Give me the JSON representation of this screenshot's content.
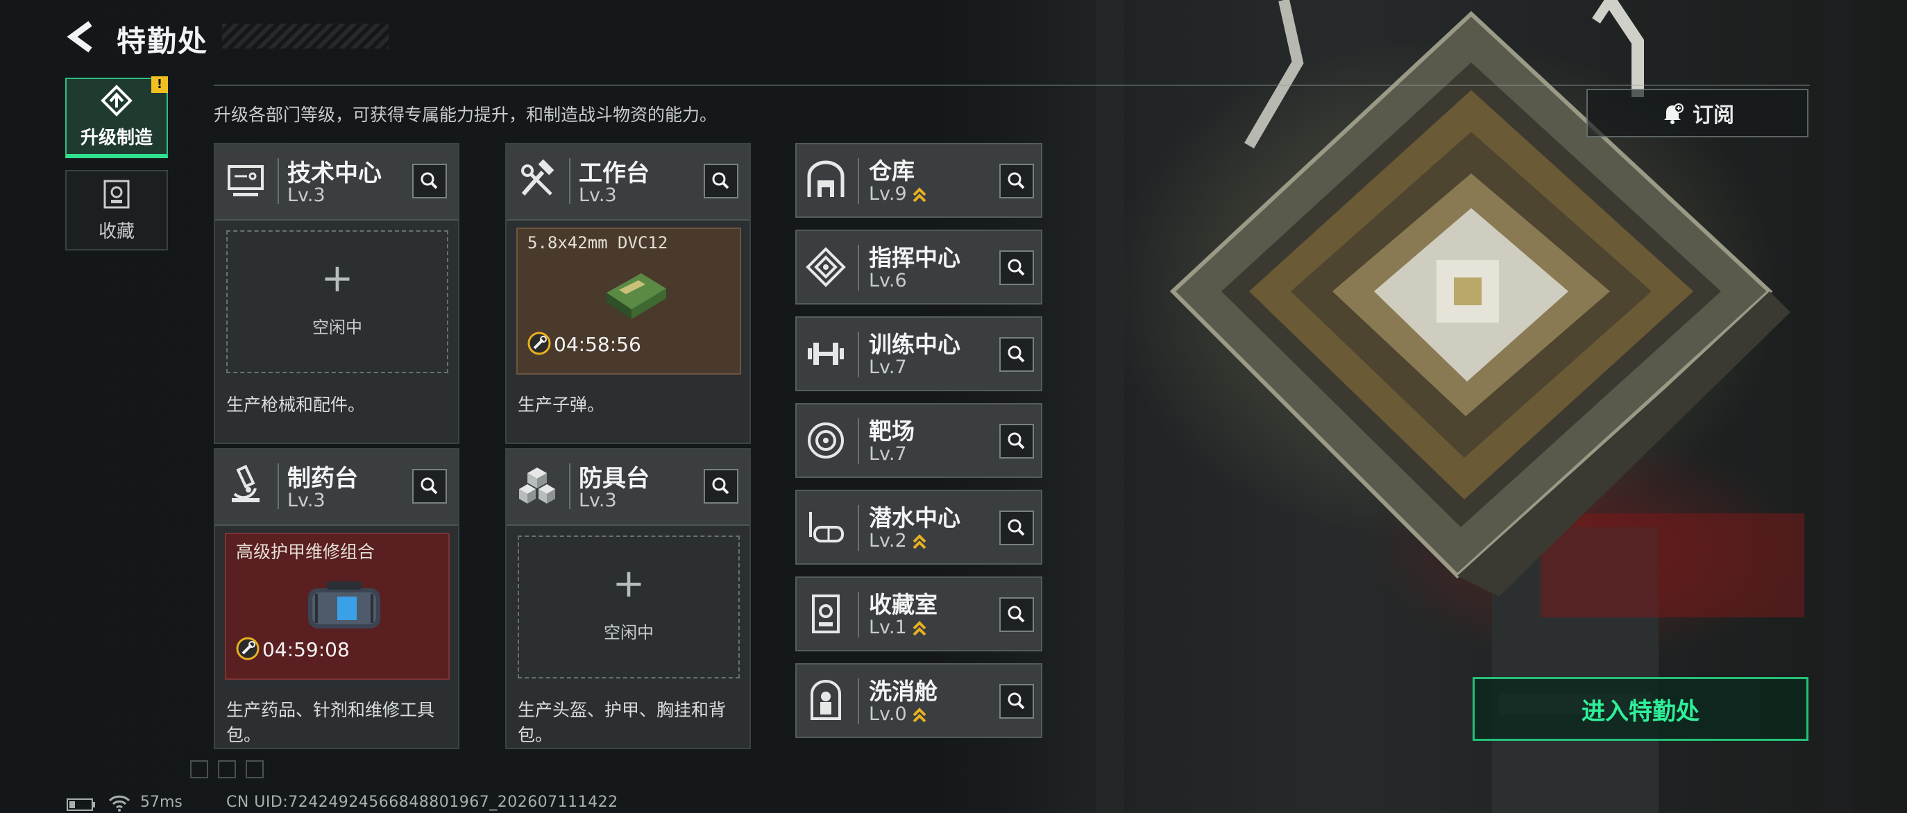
{
  "header": {
    "title": "特勤处",
    "back_icon": "back-arrow-icon"
  },
  "side_tabs": [
    {
      "label": "升级制造",
      "icon": "upgrade-factory-icon",
      "active": true,
      "alert": "!"
    },
    {
      "label": "收藏",
      "icon": "collection-icon",
      "active": false
    }
  ],
  "subtitle": "升级各部门等级，可获得专属能力提升，和制造战斗物资的能力。",
  "subscribe": {
    "label": "订阅",
    "icon": "bell-plus-icon"
  },
  "enter_button": {
    "label": "进入特勤处"
  },
  "cards": [
    {
      "name": "技术中心",
      "level": "Lv.3",
      "icon": "monitor-icon",
      "slot": {
        "state": "idle",
        "plus": "+",
        "text": "空闲中"
      },
      "desc": "生产枪械和配件。"
    },
    {
      "name": "工作台",
      "level": "Lv.3",
      "icon": "tools-icon",
      "slot": {
        "state": "producing",
        "item": "5.8x42mm DVC12",
        "timer": "04:58:56"
      },
      "desc": "生产子弹。"
    },
    {
      "name": "制药台",
      "level": "Lv.3",
      "icon": "microscope-icon",
      "slot": {
        "state": "producing",
        "item": "高级护甲维修组合",
        "timer": "04:59:08"
      },
      "desc": "生产药品、针剂和维修工具包。"
    },
    {
      "name": "防具台",
      "level": "Lv.3",
      "icon": "cubes-icon",
      "slot": {
        "state": "idle",
        "plus": "+",
        "text": "空闲中"
      },
      "desc": "生产头盔、护甲、胸挂和背包。"
    }
  ],
  "rooms": [
    {
      "name": "仓库",
      "level": "Lv.9",
      "icon": "warehouse-icon",
      "upgradable": true
    },
    {
      "name": "指挥中心",
      "level": "Lv.6",
      "icon": "command-chip-icon",
      "upgradable": false
    },
    {
      "name": "训练中心",
      "level": "Lv.7",
      "icon": "dumbbell-icon",
      "upgradable": false
    },
    {
      "name": "靶场",
      "level": "Lv.7",
      "icon": "target-icon",
      "upgradable": false
    },
    {
      "name": "潜水中心",
      "level": "Lv.2",
      "icon": "diving-mask-icon",
      "upgradable": true
    },
    {
      "name": "收藏室",
      "level": "Lv.1",
      "icon": "trophy-case-icon",
      "upgradable": true
    },
    {
      "name": "洗消舱",
      "level": "Lv.0",
      "icon": "decontamination-icon",
      "upgradable": true
    }
  ],
  "status": {
    "ping": "57ms",
    "uid": "CN UID:72424924566848801967_202607111422"
  },
  "colors": {
    "accent_green": "#2fe08f",
    "alert_yellow": "#f0c020",
    "upgrade_arrow": "#e8b020",
    "ammo_slot": "#4a3a2c",
    "med_slot": "#5a1f20"
  }
}
